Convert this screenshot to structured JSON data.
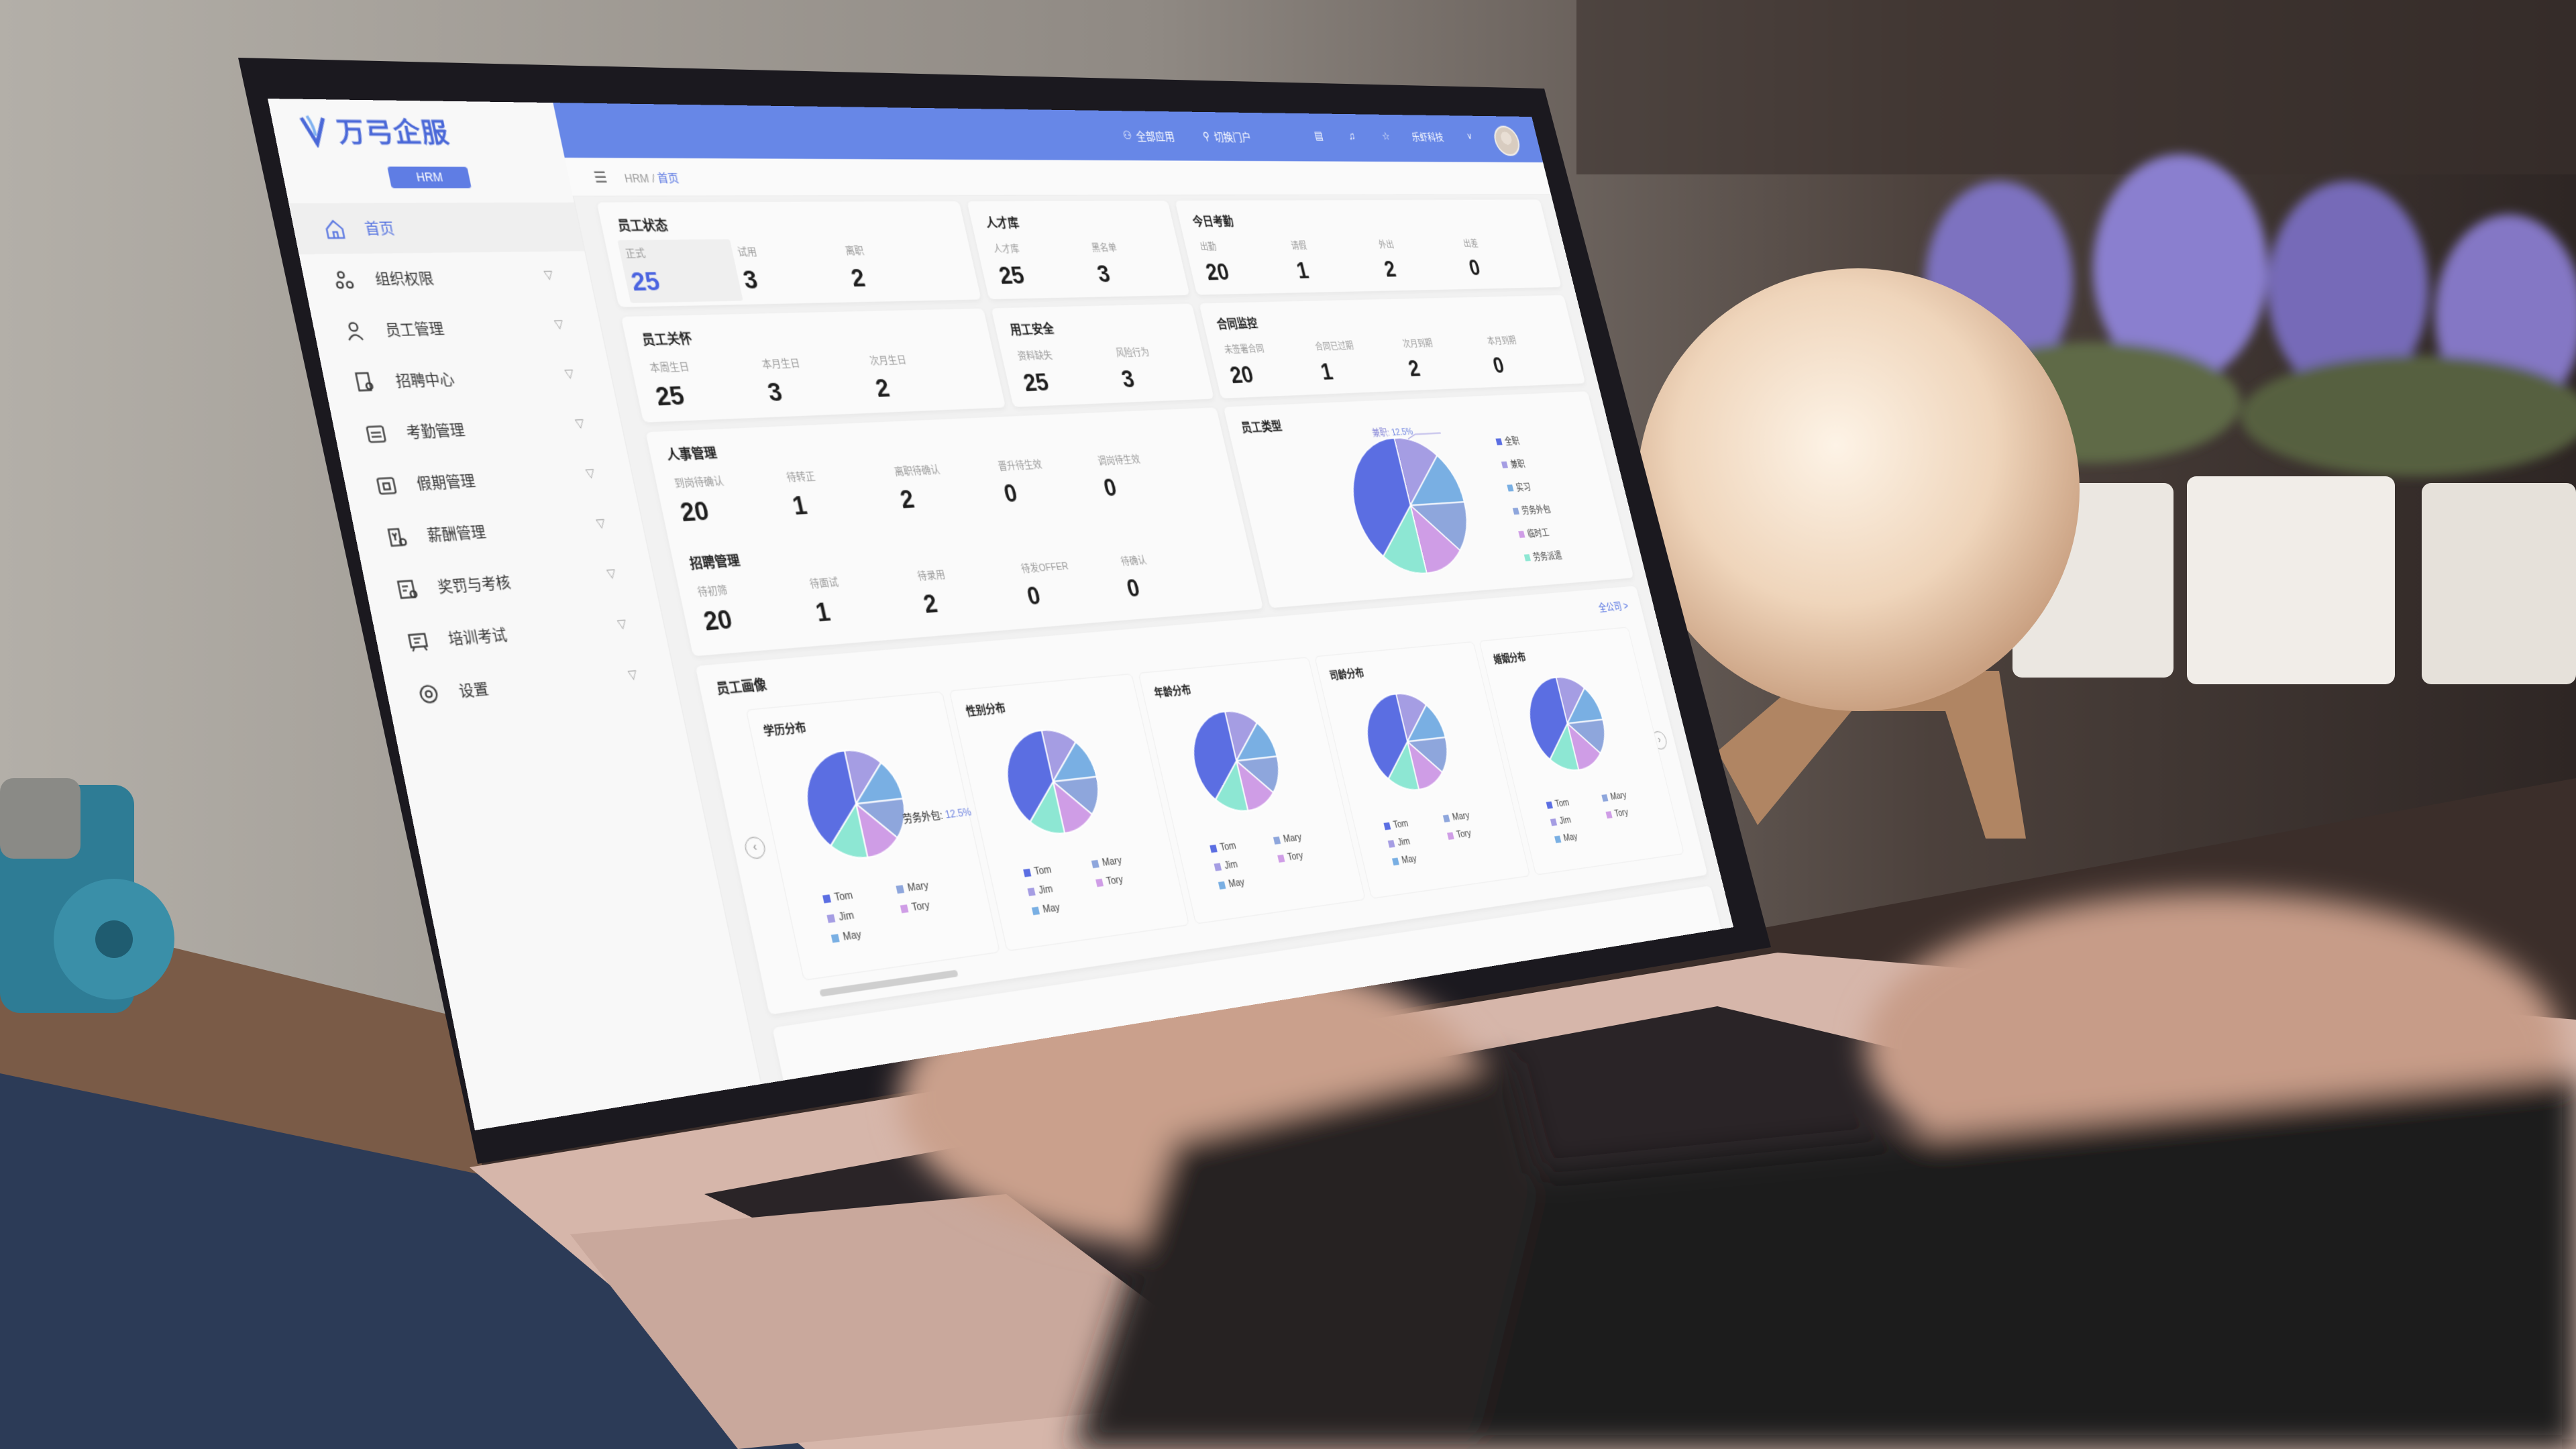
{
  "app": {
    "logo_text": "万弓企服",
    "module_button": "HRM"
  },
  "header": {
    "apps_label": "全部应用",
    "switch_label": "切换门户",
    "company": "乐虾科技",
    "icons": [
      "apps-icon",
      "switch-user-icon",
      "layout-icon",
      "bell-icon",
      "star-icon",
      "chevron-down-icon",
      "avatar"
    ]
  },
  "breadcrumb": {
    "root": "HRM",
    "sep": " / ",
    "current": "首页"
  },
  "sidebar": {
    "items": [
      {
        "label": "首页",
        "icon": "home-icon",
        "active": true
      },
      {
        "label": "组织权限",
        "icon": "org-icon"
      },
      {
        "label": "员工管理",
        "icon": "user-icon"
      },
      {
        "label": "招聘中心",
        "icon": "recruit-icon"
      },
      {
        "label": "考勤管理",
        "icon": "calendar-check-icon"
      },
      {
        "label": "假期管理",
        "icon": "calendar-leave-icon"
      },
      {
        "label": "薪酬管理",
        "icon": "salary-icon"
      },
      {
        "label": "奖罚与考核",
        "icon": "certificate-icon"
      },
      {
        "label": "培训考试",
        "icon": "board-icon"
      },
      {
        "label": "设置",
        "icon": "gear-icon"
      }
    ],
    "chevron": "▽"
  },
  "cards": [
    {
      "title": "员工状态",
      "stats": [
        {
          "label": "正式",
          "value": "25",
          "highlight": true
        },
        {
          "label": "试用",
          "value": "3"
        },
        {
          "label": "离职",
          "value": "2"
        }
      ]
    },
    {
      "title": "人才库",
      "stats": [
        {
          "label": "人才库",
          "value": "25"
        },
        {
          "label": "黑名单",
          "value": "3"
        }
      ]
    },
    {
      "title": "今日考勤",
      "stats": [
        {
          "label": "出勤",
          "value": "20"
        },
        {
          "label": "请假",
          "value": "1"
        },
        {
          "label": "外出",
          "value": "2"
        },
        {
          "label": "出差",
          "value": "0"
        }
      ]
    },
    {
      "title": "员工关怀",
      "stats": [
        {
          "label": "本周生日",
          "value": "25"
        },
        {
          "label": "本月生日",
          "value": "3"
        },
        {
          "label": "次月生日",
          "value": "2"
        }
      ]
    },
    {
      "title": "用工安全",
      "stats": [
        {
          "label": "资料缺失",
          "value": "25"
        },
        {
          "label": "风险行为",
          "value": "3"
        }
      ]
    },
    {
      "title": "合同监控",
      "stats": [
        {
          "label": "未签署合同",
          "value": "20"
        },
        {
          "label": "合同已过期",
          "value": "1"
        },
        {
          "label": "次月到期",
          "value": "2"
        },
        {
          "label": "本月到期",
          "value": "0"
        }
      ]
    },
    {
      "title": "人事管理",
      "stats": [
        {
          "label": "到岗待确认",
          "value": "20"
        },
        {
          "label": "待转正",
          "value": "1"
        },
        {
          "label": "离职待确认",
          "value": "2"
        },
        {
          "label": "晋升待生效",
          "value": "0"
        },
        {
          "label": "调岗待生效",
          "value": "0"
        }
      ]
    },
    {
      "title": "招聘管理",
      "stats": [
        {
          "label": "待初筛",
          "value": "20"
        },
        {
          "label": "待面试",
          "value": "1"
        },
        {
          "label": "待录用",
          "value": "2"
        },
        {
          "label": "待发OFFER",
          "value": "0"
        },
        {
          "label": "待确认",
          "value": "0"
        }
      ]
    }
  ],
  "portrait": {
    "title": "员工画像",
    "link": "全公司 >",
    "prev": "‹",
    "next": "›"
  },
  "chart_data": [
    {
      "type": "pie",
      "title": "员工类型",
      "slices": [
        {
          "name": "兼职",
          "value": 12.5,
          "color": "#a59de3"
        },
        {
          "name": "实习",
          "value": 12.5,
          "color": "#79afe3"
        },
        {
          "name": "劳务外包",
          "value": 12.5,
          "color": "#8ea6dc"
        },
        {
          "name": "临时工",
          "value": 12.5,
          "color": "#cf9de6"
        },
        {
          "name": "劳务派遣",
          "value": 12.5,
          "color": "#8de7d3"
        },
        {
          "name": "全职",
          "value": 37.5,
          "color": "#5b6ee2"
        }
      ],
      "legend": [
        {
          "name": "全职",
          "color": "#5b6ee2"
        },
        {
          "name": "兼职",
          "color": "#a59de3"
        },
        {
          "name": "实习",
          "color": "#79afe3"
        },
        {
          "name": "劳务外包",
          "color": "#8ea6dc"
        },
        {
          "name": "临时工",
          "color": "#cf9de6"
        },
        {
          "name": "劳务派遣",
          "color": "#8de7d3"
        }
      ],
      "callout_label": "兼职: ",
      "callout_value": "12.5%"
    },
    {
      "type": "pie",
      "title": "学历分布",
      "values": [
        12.5,
        12.5,
        12.5,
        12.5,
        12.5,
        37.5
      ],
      "colors": [
        "#a59de3",
        "#79afe3",
        "#8ea6dc",
        "#cf9de6",
        "#8de7d3",
        "#5b6ee2"
      ],
      "legend": [
        {
          "name": "Tom",
          "color": "#5b6ee2"
        },
        {
          "name": "Mary",
          "color": "#8ea6dc"
        },
        {
          "name": "Jim",
          "color": "#a59de3"
        },
        {
          "name": "Tory",
          "color": "#cf9de6"
        },
        {
          "name": "May",
          "color": "#79afe3"
        }
      ],
      "callout_label": "劳务外包: ",
      "callout_value": "12.5%"
    },
    {
      "type": "pie",
      "title": "性别分布",
      "values": [
        12.5,
        12.5,
        12.5,
        12.5,
        12.5,
        37.5
      ],
      "colors": [
        "#a59de3",
        "#79afe3",
        "#8ea6dc",
        "#cf9de6",
        "#8de7d3",
        "#5b6ee2"
      ],
      "legend": [
        {
          "name": "Tom",
          "color": "#5b6ee2"
        },
        {
          "name": "Mary",
          "color": "#8ea6dc"
        },
        {
          "name": "Jim",
          "color": "#a59de3"
        },
        {
          "name": "Tory",
          "color": "#cf9de6"
        },
        {
          "name": "May",
          "color": "#79afe3"
        }
      ]
    },
    {
      "type": "pie",
      "title": "年龄分布",
      "values": [
        12.5,
        12.5,
        12.5,
        12.5,
        12.5,
        37.5
      ],
      "colors": [
        "#a59de3",
        "#79afe3",
        "#8ea6dc",
        "#cf9de6",
        "#8de7d3",
        "#5b6ee2"
      ],
      "legend": [
        {
          "name": "Tom",
          "color": "#5b6ee2"
        },
        {
          "name": "Mary",
          "color": "#8ea6dc"
        },
        {
          "name": "Jim",
          "color": "#a59de3"
        },
        {
          "name": "Tory",
          "color": "#cf9de6"
        },
        {
          "name": "May",
          "color": "#79afe3"
        }
      ]
    },
    {
      "type": "pie",
      "title": "司龄分布",
      "values": [
        12.5,
        12.5,
        12.5,
        12.5,
        12.5,
        37.5
      ],
      "colors": [
        "#a59de3",
        "#79afe3",
        "#8ea6dc",
        "#cf9de6",
        "#8de7d3",
        "#5b6ee2"
      ],
      "legend": [
        {
          "name": "Tom",
          "color": "#5b6ee2"
        },
        {
          "name": "Mary",
          "color": "#8ea6dc"
        },
        {
          "name": "Jim",
          "color": "#a59de3"
        },
        {
          "name": "Tory",
          "color": "#cf9de6"
        },
        {
          "name": "May",
          "color": "#79afe3"
        }
      ]
    },
    {
      "type": "pie",
      "title": "婚姻分布",
      "values": [
        12.5,
        12.5,
        12.5,
        12.5,
        12.5,
        37.5
      ],
      "colors": [
        "#a59de3",
        "#79afe3",
        "#8ea6dc",
        "#cf9de6",
        "#8de7d3",
        "#5b6ee2"
      ],
      "legend": [
        {
          "name": "Tom",
          "color": "#5b6ee2"
        },
        {
          "name": "Mary",
          "color": "#8ea6dc"
        },
        {
          "name": "Jim",
          "color": "#a59de3"
        },
        {
          "name": "Tory",
          "color": "#cf9de6"
        },
        {
          "name": "May",
          "color": "#79afe3"
        }
      ]
    }
  ],
  "colors": {
    "brand": "#6787e7",
    "accent": "#4f6ee0"
  }
}
